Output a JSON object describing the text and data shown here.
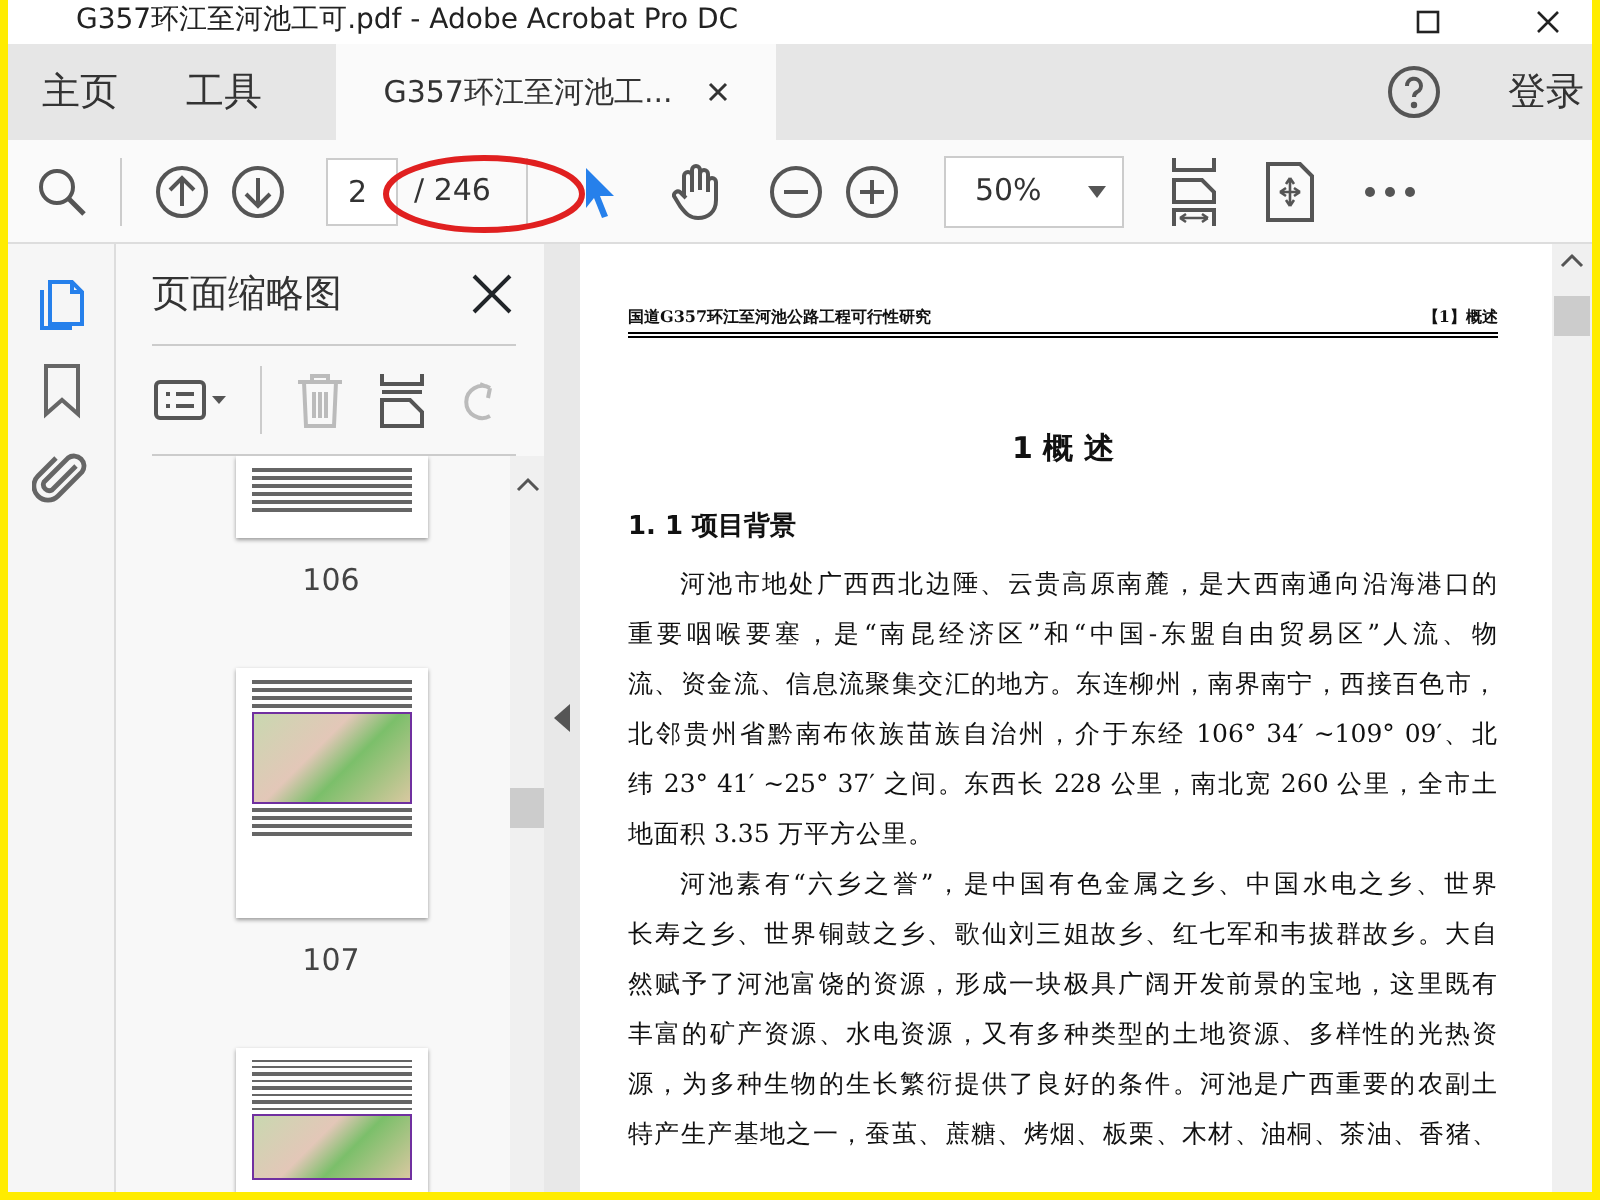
{
  "window": {
    "title": "G357环江至河池工可.pdf - Adobe Acrobat Pro DC"
  },
  "menu": [
    {
      "label": "主页"
    },
    {
      "label": "工具"
    }
  ],
  "tabs": [
    {
      "label": "G357环江至河池工...",
      "selected": true
    }
  ],
  "sign_in": "登录",
  "toolbar": {
    "page_number": "2",
    "page_total": "/ 246",
    "zoom": "50%"
  },
  "sidebar": {
    "items": [
      {
        "kind": "pages",
        "selected": true
      },
      {
        "kind": "bookmarks",
        "selected": false
      },
      {
        "kind": "attachments",
        "selected": false
      }
    ]
  },
  "thumbnail_panel": {
    "title": "页面缩略图",
    "pages": [
      {
        "kind": "text",
        "label": "106"
      },
      {
        "kind": "map",
        "label": "107"
      },
      {
        "kind": "map-bottom"
      }
    ]
  },
  "document": {
    "header_left": "国道G357环江至河池公路工程可行性研究",
    "header_right": "【1】概述",
    "title": "1 概 述",
    "section": "1. 1 项目背景",
    "paragraphs": [
      {
        "lines": [
          "河池市地处广西西北边陲、云贵高原南麓，是大西南通向沿海港口的",
          "重要咽喉要塞，是“南昆经济区”和“中国-东盟自由贸易区”人流、物",
          "流、资金流、信息流聚集交汇的地方。东连柳州，南界南宁，西接百色市，",
          "北邻贵州省黔南布依族苗族自治州，介于东经 106° 34′ ~109° 09′、北",
          "纬 23° 41′ ~25° 37′ 之间。东西长 228 公里，南北宽 260 公里，全市土",
          "地面积 3.35 万平方公里。"
        ]
      },
      {
        "lines": [
          "河池素有“六乡之誉”，是中国有色金属之乡、中国水电之乡、世界",
          "长寿之乡、世界铜鼓之乡、歌仙刘三姐故乡、红七军和韦拔群故乡。大自",
          "然赋予了河池富饶的资源，形成一块极具广阔开发前景的宝地，这里既有",
          "丰富的矿产资源、水电资源，又有多种类型的土地资源、多样性的光热资",
          "源，为多种生物的生长繁衍提供了良好的条件。河池是广西重要的农副土",
          "特产生产基地之一，蚕茧、蔗糖、烤烟、板栗、木材、油桐、茶油、香猪、"
        ]
      }
    ]
  }
}
